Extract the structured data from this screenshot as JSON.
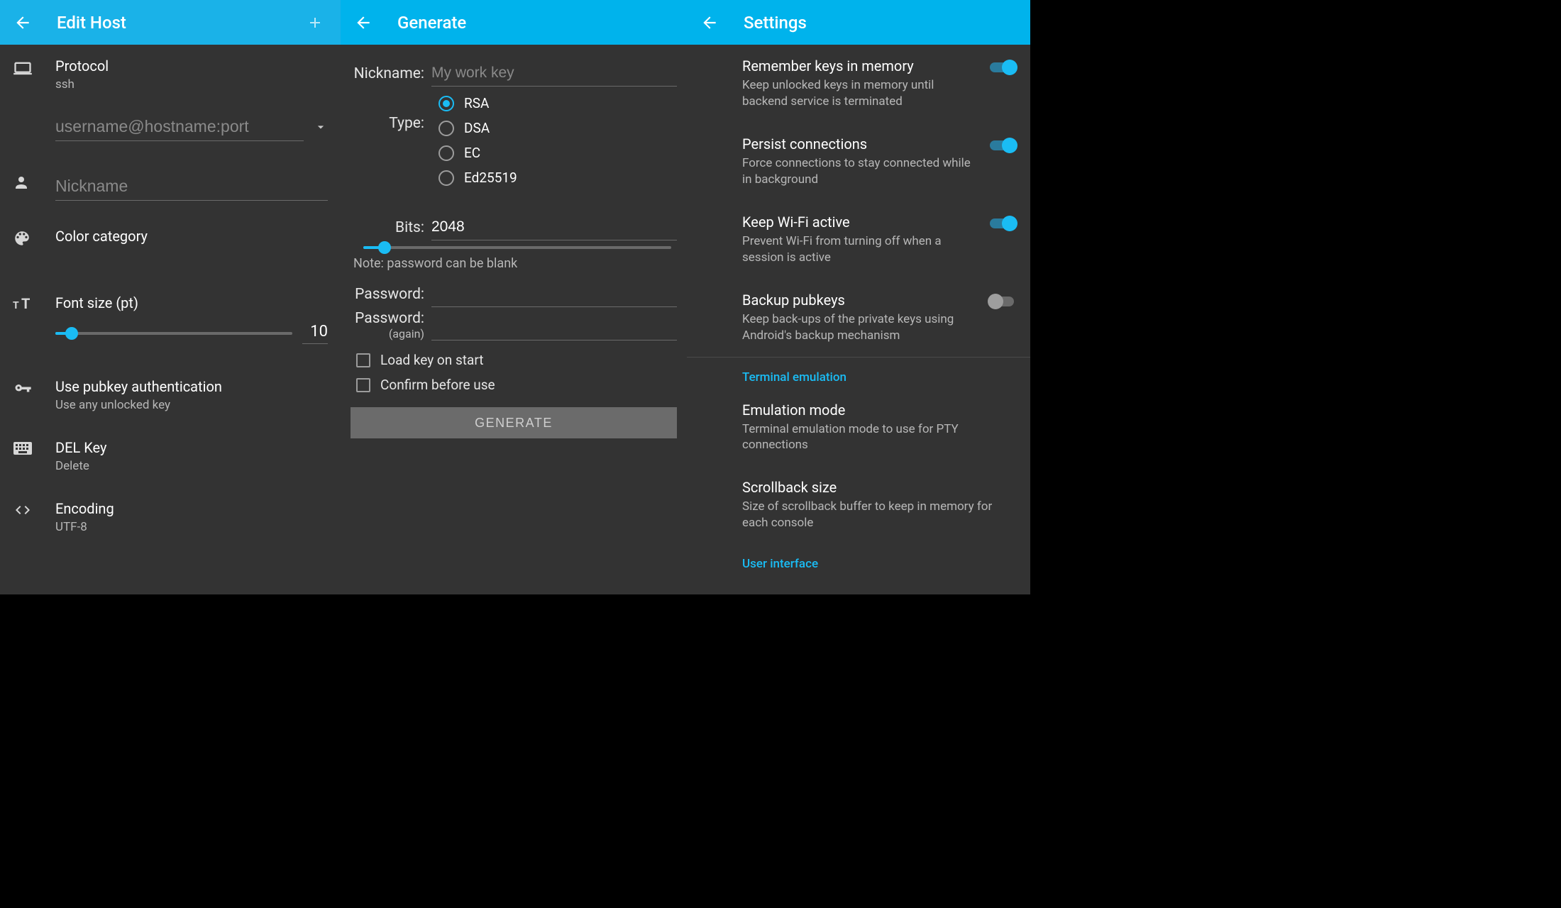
{
  "pane1": {
    "title": "Edit Host",
    "protocol": {
      "label": "Protocol",
      "value": "ssh"
    },
    "conn_placeholder": "username@hostname:port",
    "nickname_placeholder": "Nickname",
    "color_label": "Color category",
    "font": {
      "label": "Font size (pt)",
      "value": "10",
      "percent": 7
    },
    "pubkey": {
      "label": "Use pubkey authentication",
      "sub": "Use any unlocked key"
    },
    "del": {
      "label": "DEL Key",
      "sub": "Delete"
    },
    "encoding": {
      "label": "Encoding",
      "sub": "UTF-8"
    }
  },
  "pane2": {
    "title": "Generate",
    "nickname_label": "Nickname:",
    "nickname_placeholder": "My work key",
    "type_label": "Type:",
    "types": [
      "RSA",
      "DSA",
      "EC",
      "Ed25519"
    ],
    "type_selected": "RSA",
    "bits_label": "Bits:",
    "bits_value": "2048",
    "bits_percent": 7,
    "note": "Note: password can be blank",
    "password_label": "Password:",
    "password2_label": "Password:",
    "password2_sub": "(again)",
    "check1": "Load key on start",
    "check2": "Confirm before use",
    "button": "GENERATE"
  },
  "pane3": {
    "title": "Settings",
    "items": [
      {
        "title": "Remember keys in memory",
        "sub": "Keep unlocked keys in memory until backend service is terminated",
        "toggle": true,
        "on": true
      },
      {
        "title": "Persist connections",
        "sub": "Force connections to stay connected while in background",
        "toggle": true,
        "on": true
      },
      {
        "title": "Keep Wi-Fi active",
        "sub": "Prevent Wi-Fi from turning off when a session is active",
        "toggle": true,
        "on": true
      },
      {
        "title": "Backup pubkeys",
        "sub": "Keep back-ups of the private keys using Android's backup mechanism",
        "toggle": true,
        "on": false
      }
    ],
    "section1": "Terminal emulation",
    "items2": [
      {
        "title": "Emulation mode",
        "sub": "Terminal emulation mode to use for PTY connections"
      },
      {
        "title": "Scrollback size",
        "sub": "Size of scrollback buffer to keep in memory for each console"
      }
    ],
    "section2": "User interface"
  }
}
